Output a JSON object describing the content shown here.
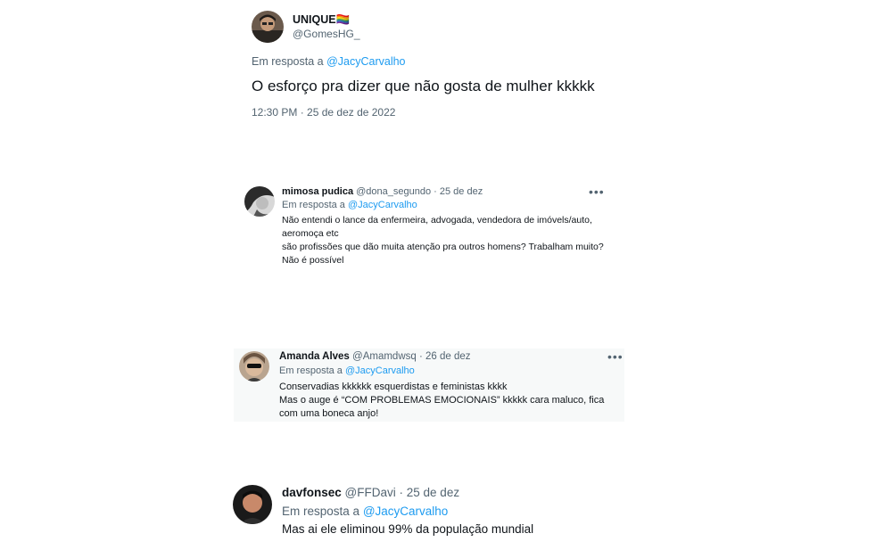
{
  "tweets": [
    {
      "avatar_icon": "user-avatar-photo",
      "name": "UNIQUE🏳️‍🌈",
      "handle": "@GomesHG_",
      "reply_prefix": "Em resposta a",
      "reply_to": "@JacyCarvalho",
      "text": "O esforço pra dizer que não gosta de mulher kkkkk",
      "timestamp": "12:30 PM · 25 de dez de 2022"
    },
    {
      "avatar_icon": "user-avatar-photo",
      "name": "mimosa pudica",
      "handle": "@dona_segundo",
      "date": "· 25 de dez",
      "reply_prefix": "Em resposta a",
      "reply_to": "@JacyCarvalho",
      "lines": [
        "Não entendi o lance da enfermeira, advogada, vendedora de imóvels/auto, aeromoça etc",
        "são profissões que dão muita atenção pra outros homens? Trabalham muito? Não é possível"
      ],
      "more_icon": "more-options-icon"
    },
    {
      "avatar_icon": "user-avatar-photo",
      "name": "Amanda Alves",
      "handle": "@Amamdwsq",
      "date": "· 26 de dez",
      "reply_prefix": "Em resposta a",
      "reply_to": "@JacyCarvalho",
      "lines": [
        "Conservadias kkkkkk esquerdistas e feministas kkkk",
        "Mas o auge é “COM PROBLEMAS EMOCIONAIS” kkkkk cara maluco, fica com uma boneca anjo!"
      ],
      "more_icon": "more-options-icon"
    },
    {
      "avatar_icon": "user-avatar-photo",
      "name": "davfonsec",
      "handle": "@FFDavi",
      "date": "· 25 de dez",
      "reply_prefix": "Em resposta a",
      "reply_to": "@JacyCarvalho",
      "text": "Mas ai ele eliminou 99% da população mundial"
    }
  ],
  "colors": {
    "link": "#1d9bf0",
    "secondary": "#536471",
    "primary": "#0f1419",
    "card": "#f7f9f9"
  }
}
